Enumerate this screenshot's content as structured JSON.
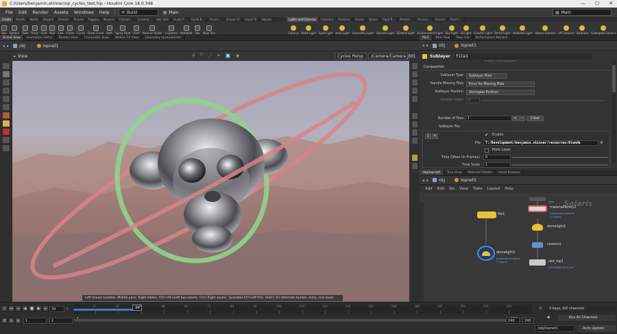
{
  "window": {
    "title": "C:/Users/benjamin.skinner/op_cycles_test.hip - Houdini Core 18.0.348",
    "controls": [
      "—",
      "☐",
      "✕"
    ]
  },
  "menu": {
    "items": [
      "File",
      "Edit",
      "Render",
      "Assets",
      "Windows",
      "Help"
    ],
    "build_label": "Build",
    "main_label": "Main",
    "desktop_label": "Main"
  },
  "shelf": {
    "tabs_left": [
      "Create",
      "Modify",
      "Model",
      "Polygon",
      "Deform",
      "Texture",
      "Rigging",
      "Muscles",
      "Charact...",
      "Constrai...",
      "Hair Utils",
      "Guide P...",
      "Guide B...",
      "Terrain...",
      "Simple FX",
      "Cloud FX",
      "Volume"
    ],
    "tabs_right": [
      "Lights and Cameras",
      "Collisions",
      "Particles",
      "Grains",
      "Vellum",
      "Rigid B...",
      "Particle...",
      "Viscous...",
      "Oceans",
      "Fluid C..."
    ],
    "tools_left": [
      "Box",
      "Sphere",
      "Tube",
      "Torus",
      "Grid",
      "Null",
      "Line",
      "Circle",
      "Curve",
      "Draw Curve",
      "Path",
      "Spray Paint",
      "Font",
      "Platonic Solids",
      "L-System",
      "Metaball",
      "File",
      "New Tool"
    ],
    "tools_right": [
      "Camera",
      "Point Light",
      "Spot Light",
      "Area Light",
      "Geometry Light",
      "Volume Light",
      "Distant Light",
      "Environment Light",
      "Sky Light",
      "GI Light",
      "Caustic Light",
      "Portal Light",
      "Ambient Light",
      "Stereo Camera",
      "VR Camera",
      "Switcher",
      "Gamepad Camera"
    ]
  },
  "viewport": {
    "tabs": [
      "Scene View",
      "Animation Editor",
      "Render View",
      "Composite View",
      "Motion FX View",
      "Geometry Spreadsheet"
    ],
    "path_obj": "obj",
    "path_node": "lopnet1",
    "view_label": "View",
    "renderer": "Cycles  Persp",
    "camera": "/Camera/Camera_001",
    "status": "Left mouse tumbles. Middle pans. Right dollies. Ctrl+Alt+Left box-zooms. Ctrl+Right zooms. Spacebar-Ctrl-Left tilts. Hold L for alternate tumble, dolly, and zoom."
  },
  "params": {
    "tabs": [
      "file1",
      "Tree View",
      "Take List",
      "Performance Monitor"
    ],
    "path_obj": "obj",
    "path_node": "lopnet1",
    "node_type": "Sublayer",
    "node_name": "file1",
    "clipped_row": "Enable Found Sublayers",
    "section": "Composition",
    "sublayer_type_label": "Sublayer Type",
    "sublayer_type_value": "Sublayer Files",
    "handle_missing_label": "Handle Missing Files",
    "handle_missing_value": "Error for Missing Files",
    "sublayer_position_label": "Sublayer Position",
    "sublayer_position_value": "Strongest Position",
    "position_index_label": "Position Index",
    "position_index_value": "0",
    "num_files_label": "Number of Files",
    "num_files_value": "1",
    "plus": "+",
    "minus": "−",
    "clear_label": "Clear",
    "sublayer_file_label": "Sublayer File",
    "multiparm_index": "1",
    "enable_label": "Enable",
    "file_label": "File",
    "file_value": "T:/Development/benjamin.skinner/resources/blende",
    "mute_label": "Mute Layer",
    "time_offset_label": "Time Offset (in Frames)",
    "time_offset_value": "0",
    "time_scale_label": "Time Scale",
    "time_scale_value": "1"
  },
  "network": {
    "tabs": [
      "/obj/lopnet1",
      "Tree View",
      "Material Palette",
      "Asset Browser"
    ],
    "path_obj": "obj",
    "path_node": "lopnet1",
    "menu": [
      "Add",
      "Edit",
      "Go",
      "View",
      "Tools",
      "Layout",
      "Help"
    ],
    "context_label": "Solaris",
    "nodes": {
      "top_sub": "/geo",
      "file": {
        "name": "file1"
      },
      "material": {
        "name": "materiallibrary1",
        "sub1": "/materials/material",
        "sub2": "2 Layers"
      },
      "domelight1": {
        "name": "domelight1"
      },
      "camera": {
        "name": "camera1"
      },
      "usd": {
        "name": "usd_rop1",
        "sub": "$HIPNAME.$OS.usd"
      },
      "domelight2": {
        "name": "domelight2",
        "sub1": "/lights/domelight2",
        "sub2": "2 Layers"
      }
    }
  },
  "timeline": {
    "current_frame": "34",
    "start_frame": "1",
    "start_frame2": "1",
    "end_frame": "240",
    "end_frame2": "240",
    "ticks": [
      "12",
      "24",
      "36",
      "48",
      "60",
      "72",
      "84",
      "96",
      "108",
      "120",
      "132",
      "144",
      "156",
      "168",
      "180",
      "192",
      "204",
      "216",
      "228"
    ],
    "keys_readout": "0 keys, 0/0 channels",
    "key_all_label": "Key All Channels",
    "path_label": "/obj/lopnet1",
    "auto_update_label": "Auto Update"
  },
  "colors": {
    "ring_green": "#8fd48a",
    "ring_red": "#d8848a",
    "node_yellow": "#e6c23a",
    "node_blue": "#4a90d9",
    "timeline_blue": "#4a78c8"
  }
}
